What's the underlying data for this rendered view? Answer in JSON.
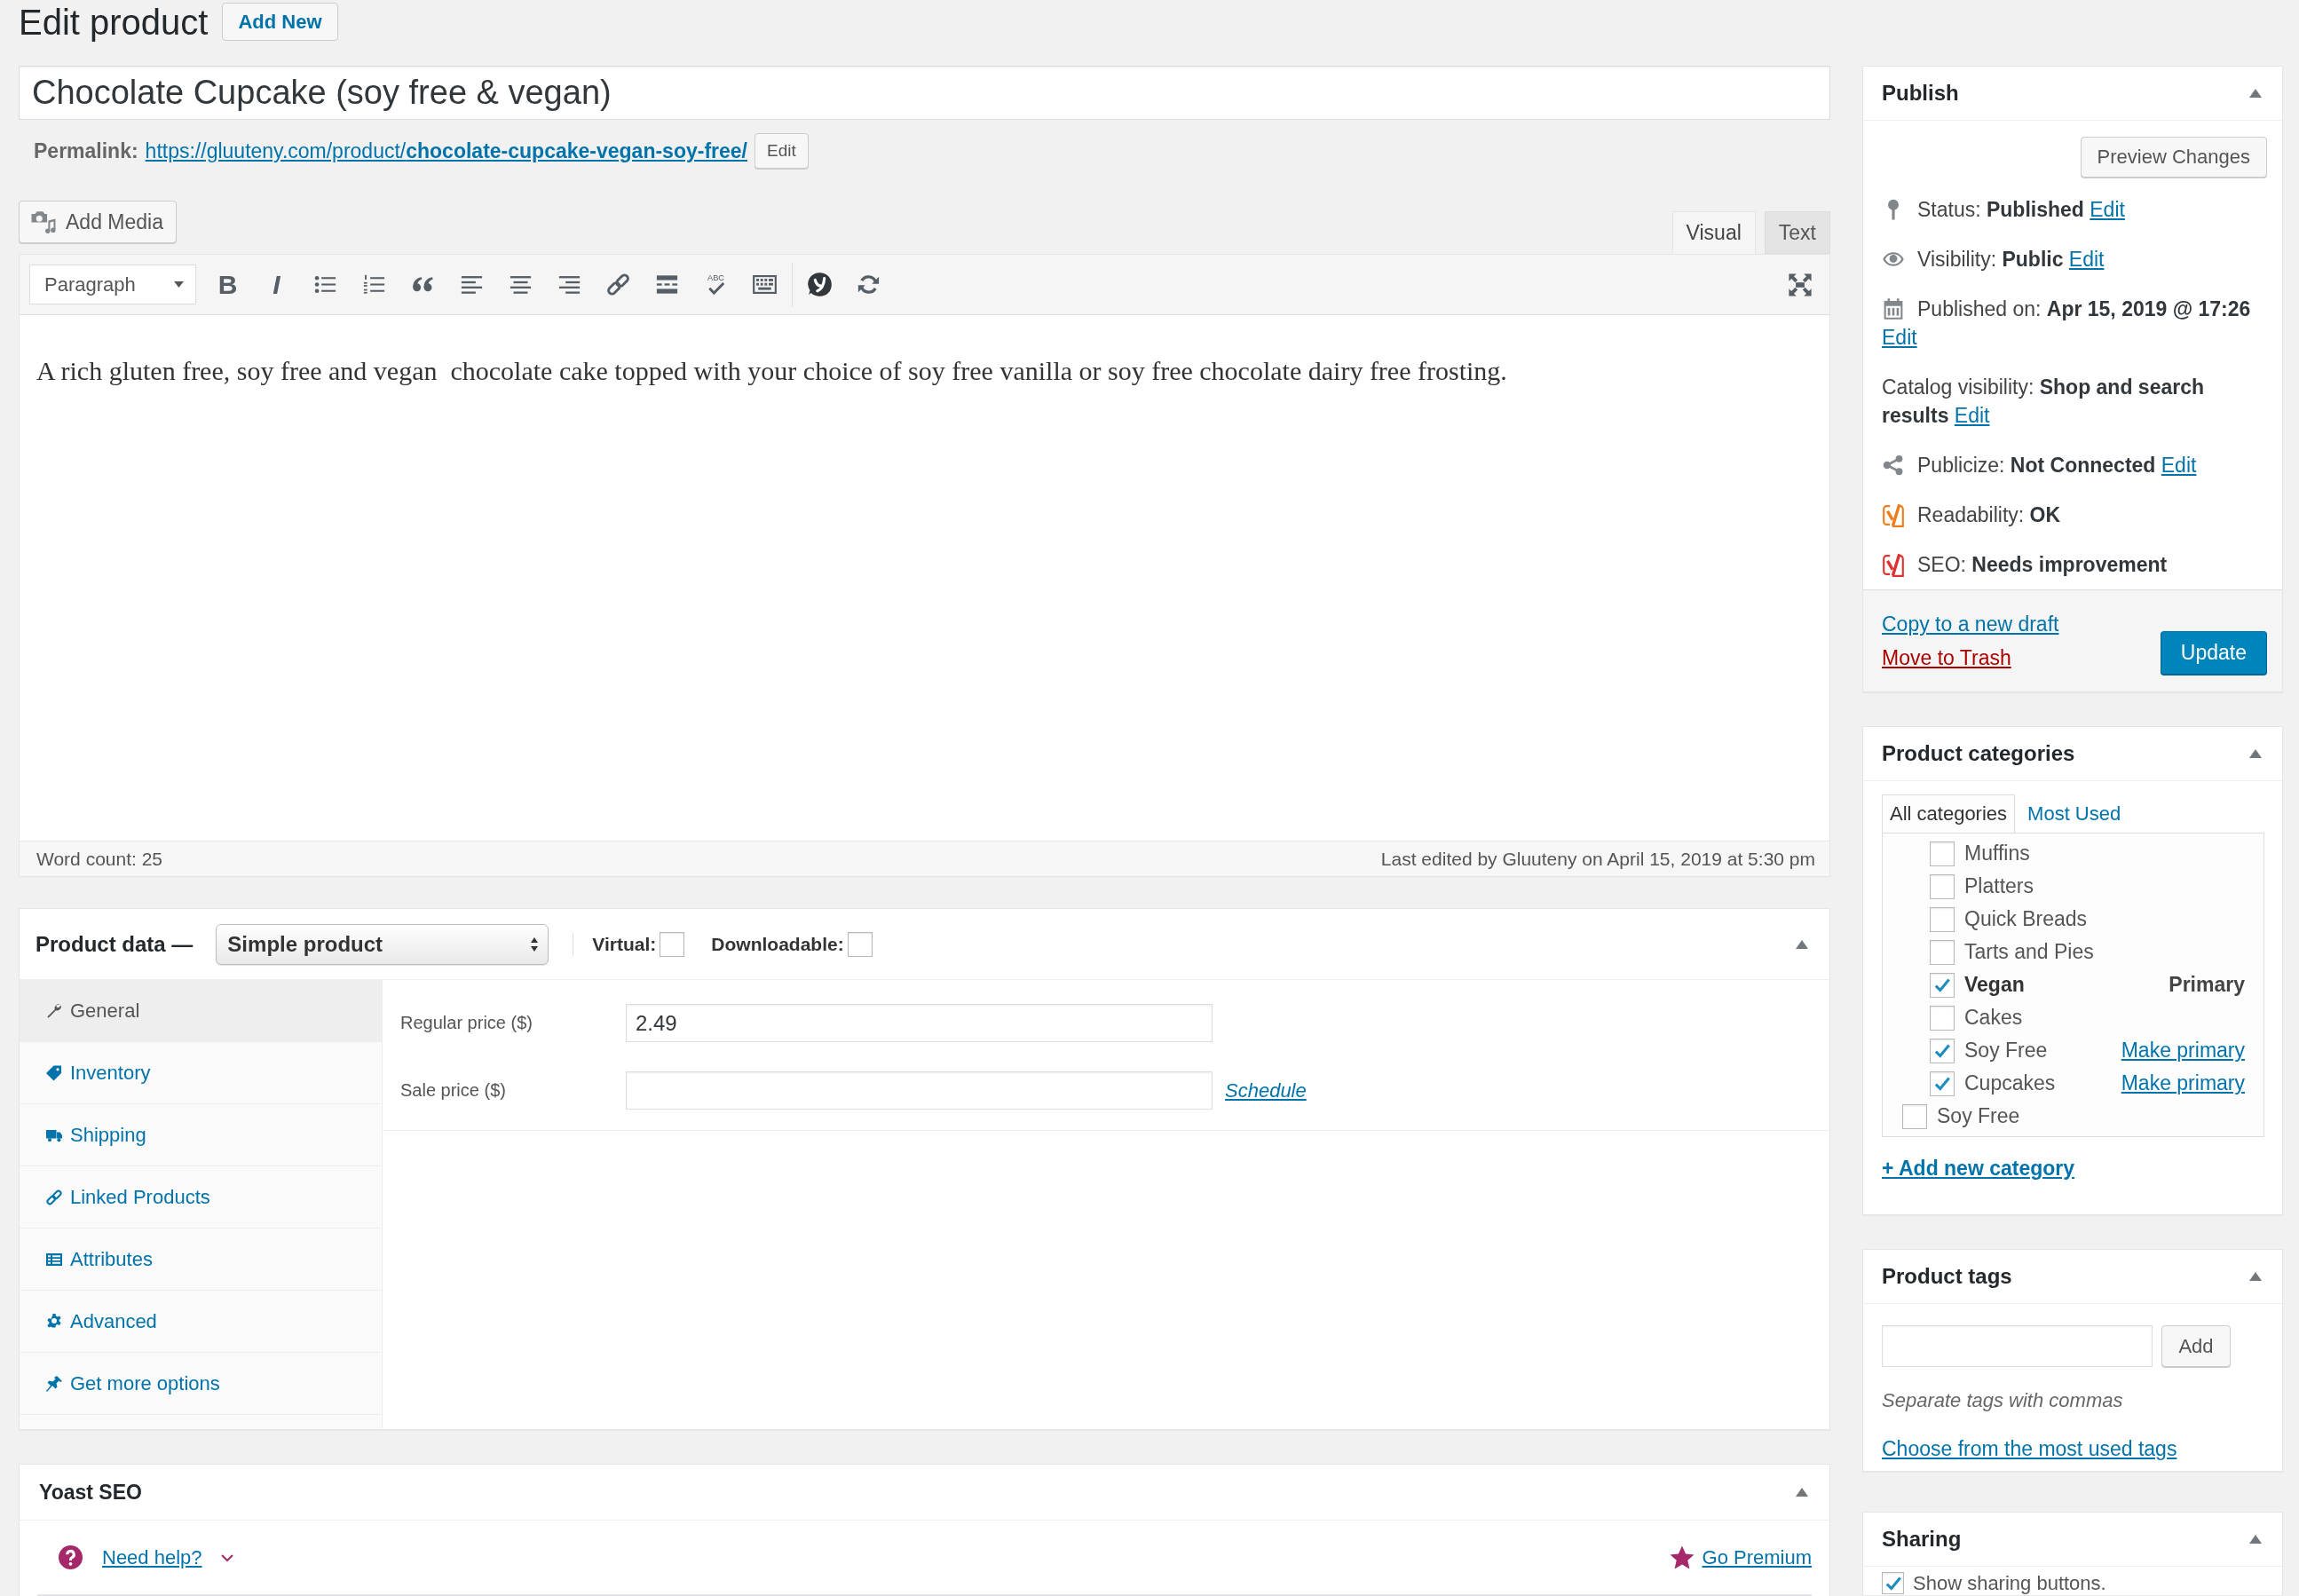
{
  "header": {
    "title": "Edit product",
    "add_new": "Add New"
  },
  "post_title": {
    "value": "Chocolate Cupcake (soy free & vegan)"
  },
  "permalink": {
    "label": "Permalink:",
    "url_base": "https://gluuteny.com/product/",
    "slug": "chocolate-cupcake-vegan-soy-free/",
    "edit": "Edit"
  },
  "editor": {
    "add_media": "Add Media",
    "tabs": [
      {
        "label": "Visual",
        "selected": true
      },
      {
        "label": "Text",
        "selected": false
      }
    ],
    "format": "Paragraph",
    "toolbar": [
      {
        "kind": "bold",
        "text": "B"
      },
      {
        "kind": "italic",
        "text": "I"
      },
      {
        "kind": "bullet_list"
      },
      {
        "kind": "numbered_list"
      },
      {
        "kind": "blockquote"
      },
      {
        "kind": "align_left"
      },
      {
        "kind": "align_center"
      },
      {
        "kind": "align_right"
      },
      {
        "kind": "link"
      },
      {
        "kind": "read_more"
      },
      {
        "kind": "spellcheck",
        "text": "ABC"
      },
      {
        "kind": "keyboard"
      },
      {
        "kind": "separator"
      },
      {
        "kind": "logo"
      },
      {
        "kind": "refresh"
      }
    ],
    "content": "A rich gluten free, soy free and vegan  chocolate cake topped with your choice of soy free vanilla or soy free chocolate dairy free frosting.",
    "word_count": "Word count: 25",
    "last_edited": "Last edited by Gluuteny on April 15, 2019 at 5:30 pm"
  },
  "product_data": {
    "title": "Product data —",
    "type": "Simple product",
    "options": [
      {
        "label": "Virtual:",
        "checked": false
      },
      {
        "label": "Downloadable:",
        "checked": false
      }
    ],
    "tabs": [
      {
        "kind": "general",
        "label": "General",
        "selected": true
      },
      {
        "kind": "inventory",
        "label": "Inventory",
        "selected": false
      },
      {
        "kind": "shipping",
        "label": "Shipping",
        "selected": false
      },
      {
        "kind": "linked",
        "label": "Linked Products",
        "selected": false
      },
      {
        "kind": "attributes",
        "label": "Attributes",
        "selected": false
      },
      {
        "kind": "advanced",
        "label": "Advanced",
        "selected": false
      },
      {
        "kind": "more",
        "label": "Get more options",
        "selected": false
      }
    ],
    "fields": [
      {
        "label": "Regular price ($)",
        "value": "2.49"
      },
      {
        "label": "Sale price ($)",
        "link": "Schedule"
      }
    ]
  },
  "yoast": {
    "title": "Yoast SEO",
    "help": "Need help?",
    "premium": "Go Premium"
  },
  "publish": {
    "title": "Publish",
    "preview": "Preview Changes",
    "rows": [
      {
        "kind": "status",
        "label": "Status:",
        "value": "Published",
        "edit": "Edit"
      },
      {
        "kind": "visibility",
        "label": "Visibility:",
        "value": "Public",
        "edit": "Edit"
      },
      {
        "kind": "date",
        "label": "Published on:",
        "value": "Apr 15, 2019 @ 17:26",
        "edit": "Edit"
      },
      {
        "kind": "catalog",
        "label": "Catalog visibility:",
        "value": "Shop and search results",
        "edit": "Edit"
      },
      {
        "kind": "publicize",
        "label": "Publicize:",
        "value": "Not Connected",
        "edit": "Edit"
      },
      {
        "kind": "score",
        "label": "Readability:",
        "value": "OK",
        "color": "#ee7c1b"
      },
      {
        "kind": "score",
        "label": "SEO:",
        "value": "Needs improvement",
        "color": "#dc3232"
      }
    ],
    "copy": "Copy to a new draft",
    "trash": "Move to Trash",
    "update": "Update"
  },
  "categories": {
    "title": "Product categories",
    "tabs": [
      {
        "label": "All categories",
        "selected": true
      },
      {
        "label": "Most Used",
        "selected": false
      }
    ],
    "items": [
      {
        "children": [
          {
            "label": "Muffins",
            "checked": false
          },
          {
            "label": "Platters",
            "checked": false
          },
          {
            "label": "Quick Breads",
            "checked": false
          },
          {
            "label": "Tarts and Pies",
            "checked": false
          },
          {
            "label": "Vegan",
            "checked": true,
            "primary": true,
            "primary_text": "Primary"
          },
          {
            "label": "Cakes",
            "checked": false
          },
          {
            "label": "Soy Free",
            "checked": true,
            "primary": false,
            "primary_text": "Make primary"
          },
          {
            "label": "Cupcakes",
            "checked": true,
            "primary": false,
            "primary_text": "Make primary"
          }
        ]
      },
      {
        "label": "Soy Free",
        "checked": false
      }
    ],
    "add_new": "+ Add new category"
  },
  "tags": {
    "title": "Product tags",
    "add": "Add",
    "hint": "Separate tags with commas",
    "choose": "Choose from the most used tags"
  },
  "sharing": {
    "title": "Sharing",
    "options": [
      {
        "label": "Show sharing buttons.",
        "checked": true
      }
    ]
  }
}
